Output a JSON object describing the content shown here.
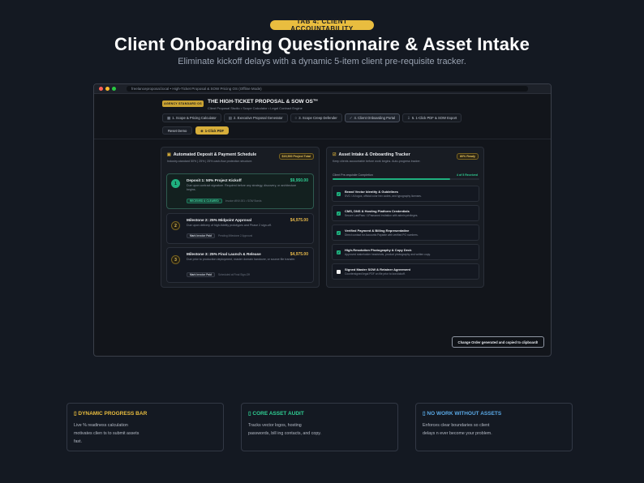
{
  "hero": {
    "tag": "TAB 4: CLIENT ACCOUNTABILITY",
    "title": "Client Onboarding Questionnaire & Asset Intake",
    "subtitle": "Eliminate kickoff delays with a dynamic 5-item client pre-requisite tracker."
  },
  "browser": {
    "url": "freelanceproposal.local • High-Ticket Proposal & SOW Pricing OS (Offline Mode)",
    "dot_colors": [
      "#ff5f57",
      "#febc2e",
      "#28c840"
    ]
  },
  "app": {
    "badge": "AGENCY STANDARD OS",
    "title": "THE HIGH-TICKET PROPOSAL & SOW OS™",
    "subtitle": "Client Proposal Studio • Scope Calculator • Legal Contract Engine",
    "tabs": [
      {
        "icon": "▦",
        "label": "1. Scope & Pricing Calculator"
      },
      {
        "icon": "▤",
        "label": "2. Executive Proposal Generator"
      },
      {
        "icon": "○",
        "label": "3. Scope Creep Defender"
      },
      {
        "icon": "✓",
        "label": "4. Client Onboarding Portal"
      },
      {
        "icon": "⇩",
        "label": "5. 1-Click PDF & SOW Export"
      }
    ],
    "reset_label": "Reset Demo",
    "pdf_label": "1-Click PDF",
    "pdf_icon": "⊕"
  },
  "schedule": {
    "title": "Automated Deposit & Payment Schedule",
    "desc": "Industry-standard 50% | 25% | 25% cash-flow protection structure.",
    "total": "$19,500 Project Total",
    "milestones": [
      {
        "num": "1",
        "title": "Deposit 1: 50% Project Kickoff",
        "amount": "$9,950.00",
        "desc": "Due upon contract signature. Required before any strategy, discovery, or architecture begins.",
        "chip": "RECEIVED & CLEARED",
        "meta": "Invoice #INV-001 • SOW Bonds"
      },
      {
        "num": "2",
        "title": "Milestone 2: 25% Midpoint Approval",
        "amount": "$4,975.00",
        "desc": "Due upon delivery of high-fidelity prototypes and Phase 2 sign-off.",
        "chip": "Mark Invoice Paid",
        "meta": "Pending Milestone 2 Approval"
      },
      {
        "num": "3",
        "title": "Milestone 3: 25% Final Launch & Release",
        "amount": "$4,975.00",
        "desc": "Due prior to production deployment, master domain handover, or source file transfer.",
        "chip": "Mark Invoice Paid",
        "meta": "Scheduled at Final Sign-Off"
      }
    ]
  },
  "tracker": {
    "title": "Asset Intake & Onboarding Tracker",
    "desc": "Keep clients accountable before work begins. Auto-progress tracker.",
    "ready": "80% Ready",
    "progress_label": "Client Pre-requisite Completion",
    "progress_count": "4 of 5 Received",
    "progress_fraction": 0.8,
    "items": [
      {
        "checked": true,
        "title": "Brand Vector Identity & Guidelines",
        "desc": "SVG / AI logos, official color hex codes, and typography licenses."
      },
      {
        "checked": true,
        "title": "CMS, DNS & Hosting Platform Credentials",
        "desc": "Secure LastPass / 1Password invitation with admin privileges."
      },
      {
        "checked": true,
        "title": "Verified Payment & Billing Representative",
        "desc": "Direct contact for Accounts Payable with verified PO numbers."
      },
      {
        "checked": true,
        "title": "High-Resolution Photography & Copy Deck",
        "desc": "Approved stakeholder headshots, product photography and written copy."
      },
      {
        "checked": false,
        "title": "Signed Master SOW & Retainer Agreement",
        "desc": "Countersigned legal PDF on file prior to low kickoff."
      }
    ]
  },
  "toast": "Change Order generated and copied to clipboard!",
  "features": [
    {
      "icon": "▯",
      "title": "DYNAMIC PROGRESS BAR",
      "color": "#e9bd3f",
      "desc": "Live % readiness calculation motivates clien ts to submit assets fast."
    },
    {
      "icon": "▯",
      "title": "CORE ASSET AUDIT",
      "color": "#2fcf94",
      "desc": "Tracks vector logos, hosting passwords, bill ing contacts, and copy."
    },
    {
      "icon": "▯",
      "title": "NO WORK WITHOUT ASSETS",
      "color": "#5aa9e6",
      "desc": "Enforces clear boundaries so client delays n ever become your problem."
    }
  ]
}
